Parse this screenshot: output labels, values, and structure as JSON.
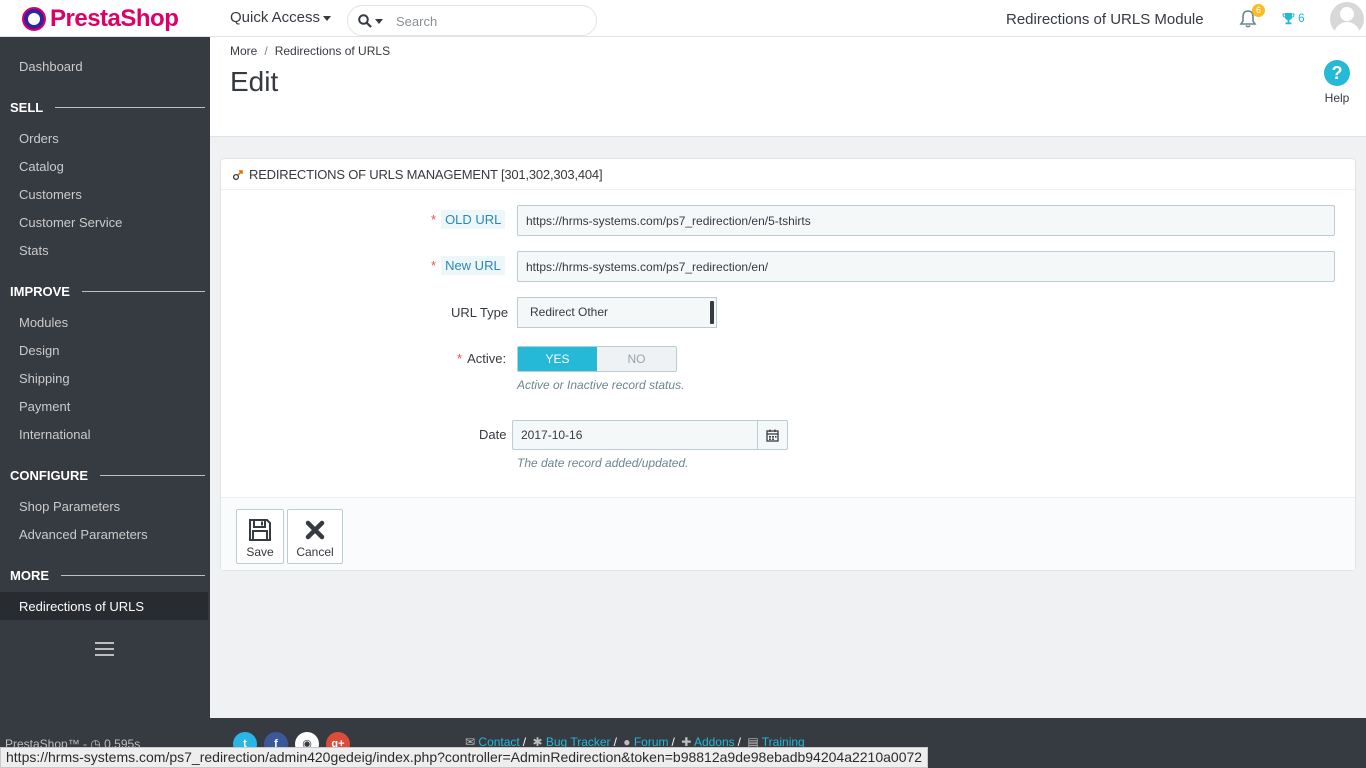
{
  "header": {
    "logo_text": "PrestaShop",
    "quick_access_label": "Quick Access",
    "search_placeholder": "Search",
    "shop_title": "Redirections of URLS Module",
    "notification_count": "6",
    "trophy_count": "6"
  },
  "sidebar": {
    "dashboard": "Dashboard",
    "sections": [
      {
        "title": "SELL",
        "items": [
          "Orders",
          "Catalog",
          "Customers",
          "Customer Service",
          "Stats"
        ]
      },
      {
        "title": "IMPROVE",
        "items": [
          "Modules",
          "Design",
          "Shipping",
          "Payment",
          "International"
        ]
      },
      {
        "title": "CONFIGURE",
        "items": [
          "Shop Parameters",
          "Advanced Parameters"
        ]
      },
      {
        "title": "MORE",
        "items": [
          "Redirections of URLS"
        ]
      }
    ],
    "active_item": "Redirections of URLS"
  },
  "page": {
    "breadcrumb": [
      "More",
      "Redirections of URLS"
    ],
    "title": "Edit",
    "help_label": "Help"
  },
  "form": {
    "heading": "REDIRECTIONS OF URLS MANAGEMENT [301,302,303,404]",
    "old_url_label": "OLD URL",
    "old_url_value": "https://hrms-systems.com/ps7_redirection/en/5-tshirts",
    "new_url_label": "New URL",
    "new_url_value": "https://hrms-systems.com/ps7_redirection/en/",
    "url_type_label": "URL Type",
    "url_type_value": "Redirect Other",
    "active_label": "Active:",
    "active_yes": "YES",
    "active_no": "NO",
    "active_value": true,
    "active_help": "Active or Inactive record status.",
    "date_label": "Date",
    "date_value": "2017-10-16",
    "date_help": "The date record added/updated.",
    "save_label": "Save",
    "cancel_label": "Cancel"
  },
  "footer": {
    "version_text": "PrestaShop™ - ◷ 0.595s",
    "social": [
      "twitter",
      "facebook",
      "github",
      "google-plus"
    ],
    "links": [
      "Contact",
      "Bug Tracker",
      "Forum",
      "Addons",
      "Training"
    ]
  },
  "statusbar": {
    "url": "https://hrms-systems.com/ps7_redirection/admin420gedeig/index.php?controller=AdminRedirection&token=b98812a9de98ebadb94204a2210a0072"
  },
  "colors": {
    "accent": "#25b9d7",
    "brand": "#df0067",
    "sidebar_bg": "#363a41",
    "required": "#f54c3e"
  }
}
